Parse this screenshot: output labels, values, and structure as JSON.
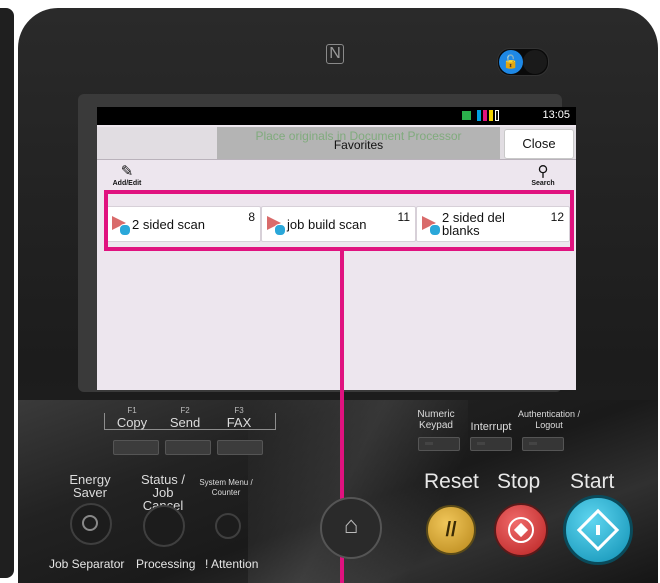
{
  "screen": {
    "status_time": "13:05",
    "title_ghost": "Place originals in Document Processor",
    "title": "Favorites",
    "close_label": "Close",
    "add_edit_label": "Add/Edit",
    "search_label": "Search",
    "favorites": [
      {
        "name": "2 sided scan",
        "number": "8"
      },
      {
        "name": "job build scan",
        "number": "11"
      },
      {
        "name": "2 sided del blanks",
        "number": "12"
      }
    ]
  },
  "function_keys": [
    {
      "fn": "F1",
      "label": "Copy"
    },
    {
      "fn": "F2",
      "label": "Send"
    },
    {
      "fn": "F3",
      "label": "FAX"
    }
  ],
  "right_keys": {
    "numeric_keypad": "Numeric Keypad",
    "interrupt": "Interrupt",
    "auth_logout": "Authentication / Logout"
  },
  "left_buttons": {
    "energy_saver": "Energy Saver",
    "status_job_cancel": "Status / Job Cancel",
    "system_menu_counter": "System Menu / Counter"
  },
  "action_buttons": {
    "reset": "Reset",
    "stop": "Stop",
    "start": "Start"
  },
  "bottom_labels": {
    "job_separator": "Job Separator",
    "processing": "Processing",
    "attention": "! Attention"
  },
  "colors": {
    "highlight": "#e0127f",
    "reset": "#d1a22a",
    "stop": "#d13a3a",
    "start": "#13a9cf",
    "lock_toggle": "#1e88e5"
  }
}
